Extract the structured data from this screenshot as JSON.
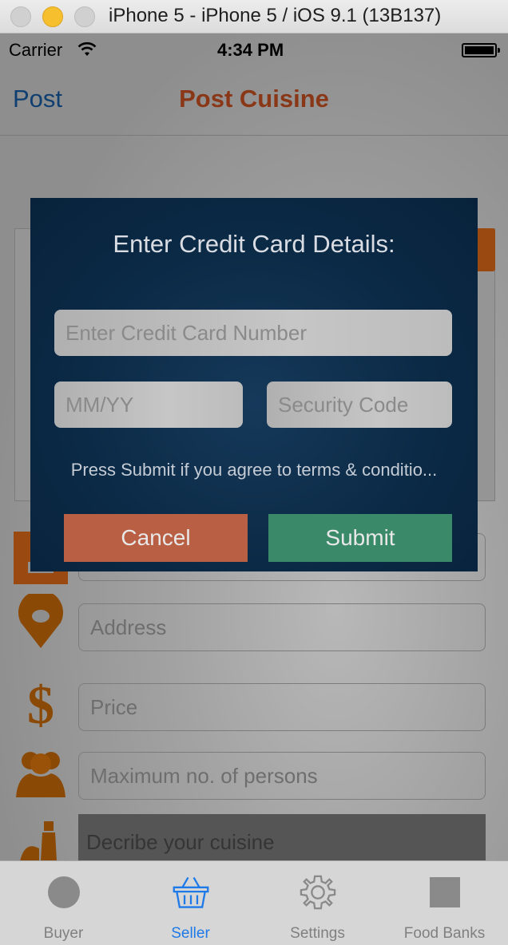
{
  "window": {
    "title": "iPhone 5 - iPhone 5 / iOS 9.1 (13B137)"
  },
  "status_bar": {
    "carrier": "Carrier",
    "time": "4:34 PM"
  },
  "nav": {
    "back_label": "Post",
    "title": "Post Cuisine"
  },
  "form": {
    "address_placeholder": "Address",
    "price_placeholder": "Price",
    "persons_placeholder": "Maximum no. of persons",
    "describe_placeholder": "Decribe your cuisine"
  },
  "modal": {
    "title": "Enter Credit Card Details:",
    "card_placeholder": "Enter Credit Card Number",
    "expiry_placeholder": "MM/YY",
    "security_placeholder": "Security Code",
    "terms": "Press Submit if you agree to terms & conditio...",
    "cancel_label": "Cancel",
    "submit_label": "Submit"
  },
  "tabs": [
    {
      "label": "Buyer",
      "icon": "circle-icon",
      "active": false
    },
    {
      "label": "Seller",
      "icon": "basket-icon",
      "active": true
    },
    {
      "label": "Settings",
      "icon": "gear-icon",
      "active": false
    },
    {
      "label": "Food Banks",
      "icon": "square-icon",
      "active": false
    }
  ],
  "colors": {
    "accent_orange": "#9a4a10",
    "tab_active": "#1e7ae8",
    "modal_bg": "#0b2a46",
    "cancel": "#b85f44",
    "submit": "#3a8a6a"
  }
}
